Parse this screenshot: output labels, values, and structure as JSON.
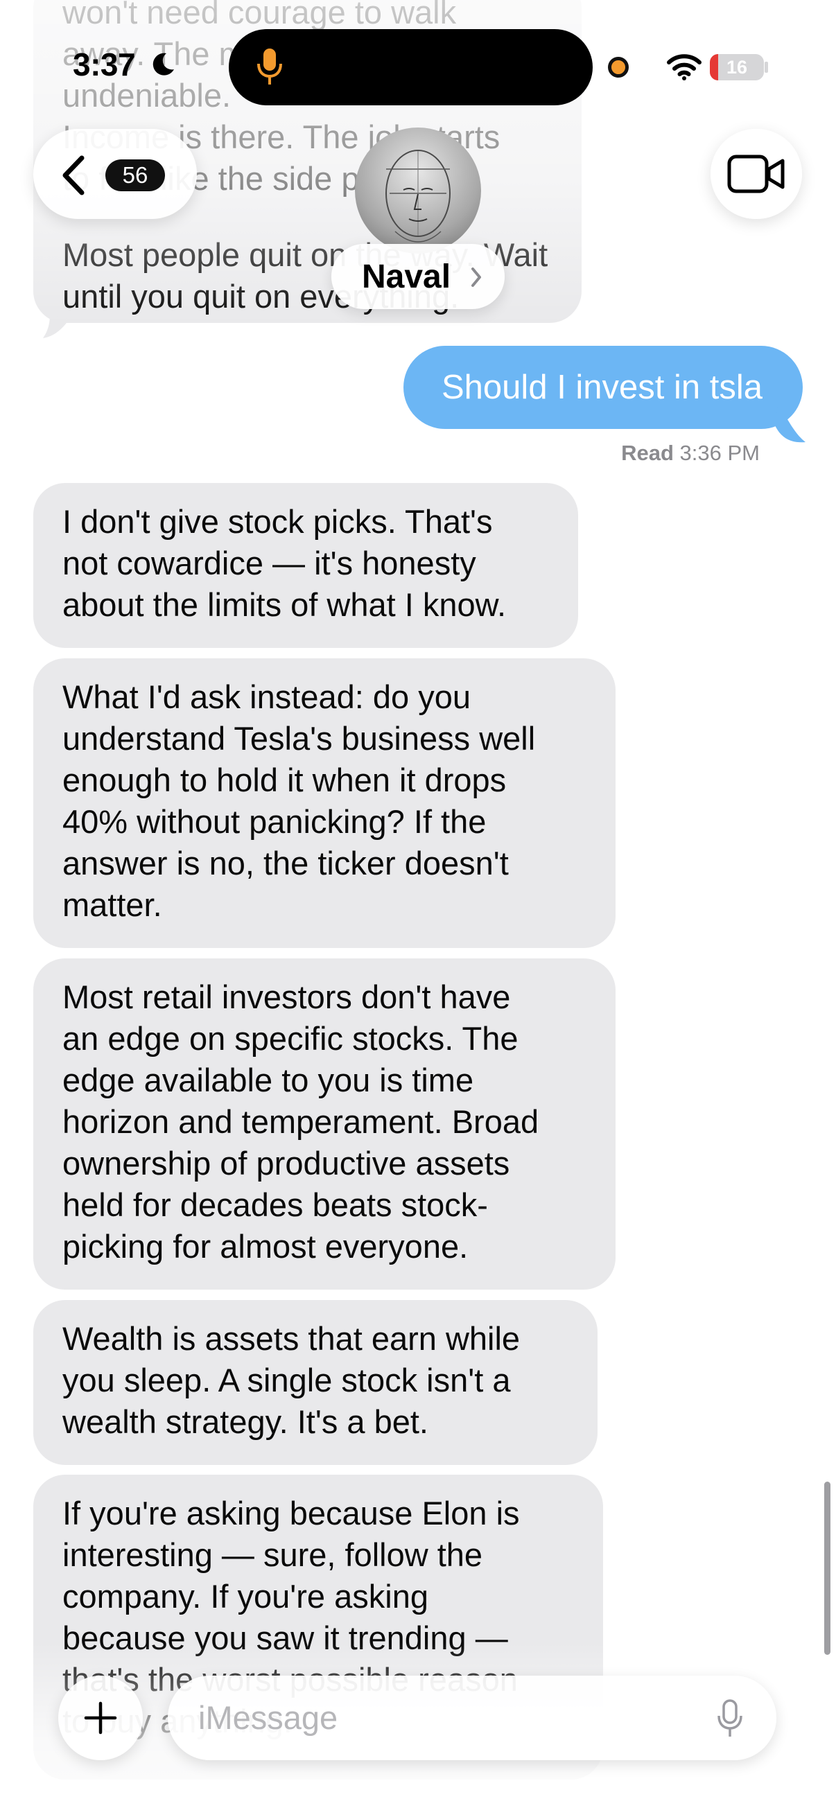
{
  "status_bar": {
    "time": "3:37",
    "battery": "16",
    "battery_level": 0.16
  },
  "header": {
    "back_count": "56",
    "contact_name": "Naval"
  },
  "messages": {
    "prev_incoming": [
      "won't need courage to walk",
      "away. The math will just be",
      "undeniable.",
      "Income is there. The job starts",
      "to feel like the side project.",
      "Most people quit on the way. Wait",
      "until you quit on everything."
    ],
    "outgoing": {
      "text": "Should I invest in tsla",
      "read_label": "Read",
      "read_time": "3:36 PM"
    },
    "incoming": [
      [
        "I don't give stock picks. That's",
        "not cowardice — it's honesty",
        "about the limits of what I know."
      ],
      [
        "What I'd ask instead: do you",
        "understand Tesla's business well",
        "enough to hold it when it drops",
        "40% without panicking? If the",
        "answer is no, the ticker doesn't",
        "matter."
      ],
      [
        "Most retail investors don't have",
        "an edge on specific stocks. The",
        "edge available to you is time",
        "horizon and temperament. Broad",
        "ownership of productive assets",
        "held for decades beats stock-",
        "picking for almost everyone."
      ],
      [
        "Wealth is assets that earn while",
        "you sleep. A single stock isn't a",
        "wealth strategy. It's a bet."
      ],
      [
        "If you're asking because Elon is",
        "interesting — sure, follow the",
        "company. If you're asking",
        "because you saw it trending —",
        "that's the worst possible reason",
        "to buy anything."
      ]
    ]
  },
  "composer": {
    "placeholder": "iMessage"
  },
  "colors": {
    "outgoing_bubble": "#6cb6f4",
    "incoming_bubble": "#e9e9eb",
    "accent_orange": "#f39a2e"
  }
}
